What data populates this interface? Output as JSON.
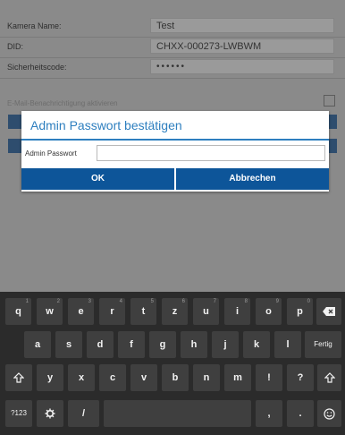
{
  "form": {
    "rows": [
      {
        "label": "Kamera Name:",
        "value": "Test"
      },
      {
        "label": "DID:",
        "value": "CHXX-000273-LWBWM"
      },
      {
        "label": "Sicherheitscode:",
        "value": "••••••"
      }
    ],
    "notification_label": "E-Mail-Benachrichtigung aktivieren"
  },
  "dialog": {
    "title": "Admin Passwort bestätigen",
    "field_label": "Admin Passwort",
    "field_value": "",
    "ok_label": "OK",
    "cancel_label": "Abbrechen"
  },
  "keyboard": {
    "row1": [
      {
        "key": "q",
        "sub": "1"
      },
      {
        "key": "w",
        "sub": "2"
      },
      {
        "key": "e",
        "sub": "3"
      },
      {
        "key": "r",
        "sub": "4"
      },
      {
        "key": "t",
        "sub": "5"
      },
      {
        "key": "z",
        "sub": "6"
      },
      {
        "key": "u",
        "sub": "7"
      },
      {
        "key": "i",
        "sub": "8"
      },
      {
        "key": "o",
        "sub": "9"
      },
      {
        "key": "p",
        "sub": "0"
      }
    ],
    "row2": [
      "a",
      "s",
      "d",
      "f",
      "g",
      "h",
      "j",
      "k",
      "l"
    ],
    "row3": [
      "y",
      "x",
      "c",
      "v",
      "b",
      "n",
      "m",
      "!",
      "?"
    ],
    "done_label": "Fertig",
    "symbols_label": "?123",
    "slash_label": "/",
    "comma_label": ",",
    "period_label": ".",
    "icons": {
      "backspace": "backspace-icon",
      "shift": "shift-icon",
      "settings": "settings-icon",
      "emoji": "emoji-icon"
    }
  }
}
